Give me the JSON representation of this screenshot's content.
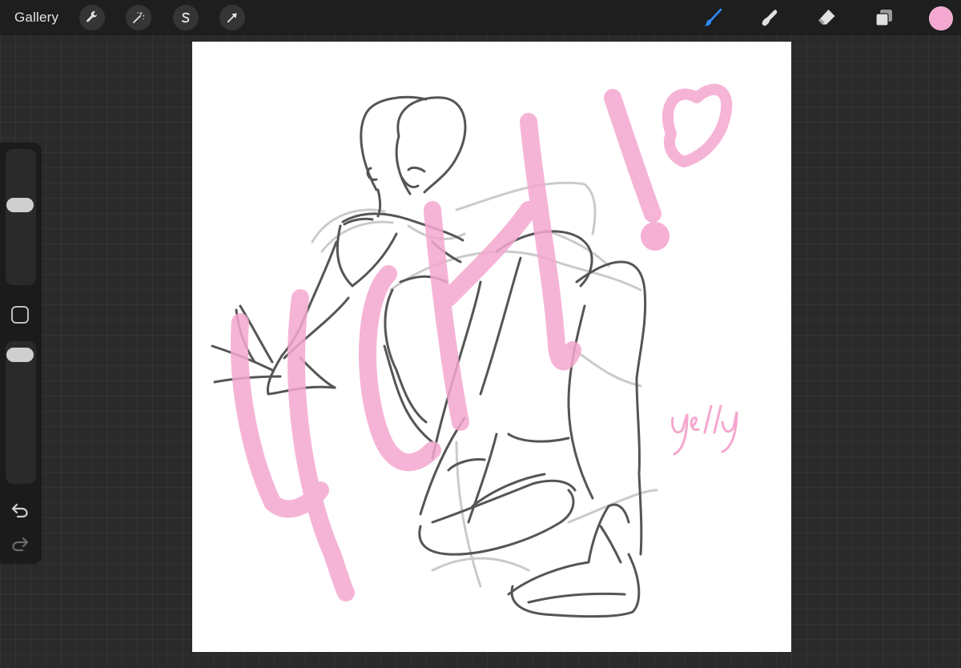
{
  "topbar": {
    "gallery_label": "Gallery",
    "left_tools": [
      {
        "name": "actions",
        "icon": "wrench-icon"
      },
      {
        "name": "adjustments",
        "icon": "magic-wand-icon"
      },
      {
        "name": "selection",
        "icon": "selection-s-icon"
      },
      {
        "name": "transform",
        "icon": "arrow-cursor-icon"
      }
    ],
    "right_tools": [
      {
        "name": "brush",
        "icon": "brush-icon",
        "active": true
      },
      {
        "name": "smudge",
        "icon": "smudge-finger-icon",
        "active": false
      },
      {
        "name": "eraser",
        "icon": "eraser-icon",
        "active": false
      },
      {
        "name": "layers",
        "icon": "layers-icon",
        "active": false
      }
    ],
    "current_color": "#f4a7cf"
  },
  "sidebar": {
    "brush_size_level": 0.6,
    "opacity_level": 0.95,
    "modify_icon": "square-modify-icon",
    "undo_icon": "undo-icon",
    "redo_icon": "redo-icon"
  },
  "canvas": {
    "background": "#ffffff",
    "sketch_color": "#555555",
    "lettering_color": "#f4a7cf",
    "lettering_text": "YCH!",
    "signature_text": "yelly"
  }
}
